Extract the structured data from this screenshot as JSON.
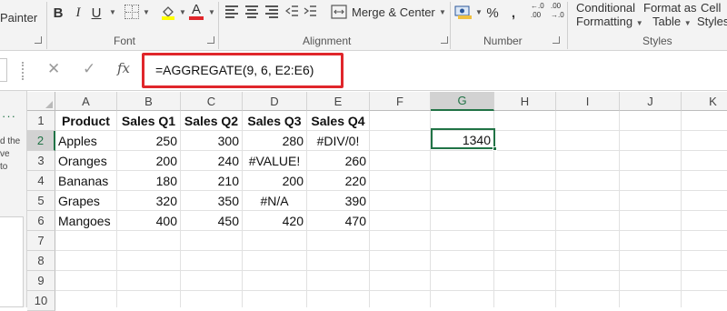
{
  "ribbon": {
    "painter_label": "Painter",
    "bold_label": "B",
    "italic_label": "I",
    "underline_label": "U",
    "font_color_glyph": "A",
    "font_group_label": "Font",
    "merge_center_label": "Merge & Center",
    "alignment_group_label": "Alignment",
    "percent_label": "%",
    "comma_label": ",",
    "increase_decimal_top": "←.0",
    "increase_decimal_bottom": ".00",
    "decrease_decimal_top": ".00",
    "decrease_decimal_bottom": "→.0",
    "number_group_label": "Number",
    "conditional_formatting_line1": "Conditional",
    "conditional_formatting_line2": "Formatting",
    "format_as_table_line1": "Format as",
    "format_as_table_line2": "Table",
    "cell_styles_line1": "Cell",
    "cell_styles_line2": "Styles",
    "styles_group_label": "Styles",
    "accent_color": "#e0262b"
  },
  "formula_bar": {
    "cancel_glyph": "✕",
    "enter_glyph": "✓",
    "fx_label": "fx",
    "formula": "=AGGREGATE(9, 6, E2:E6)"
  },
  "left_pane": {
    "dots": "···",
    "text_lines": [
      "d the",
      "ve",
      "to"
    ]
  },
  "columns": [
    "A",
    "B",
    "C",
    "D",
    "E",
    "F",
    "G",
    "H",
    "I",
    "J",
    "K"
  ],
  "rows": [
    "1",
    "2",
    "3",
    "4",
    "5",
    "6",
    "7",
    "8",
    "9",
    "10"
  ],
  "headers": [
    "Product",
    "Sales Q1",
    "Sales Q2",
    "Sales Q3",
    "Sales Q4"
  ],
  "data": [
    [
      "Apples",
      "250",
      "300",
      "280",
      "#DIV/0!"
    ],
    [
      "Oranges",
      "200",
      "240",
      "#VALUE!",
      "260"
    ],
    [
      "Bananas",
      "180",
      "210",
      "200",
      "220"
    ],
    [
      "Grapes",
      "320",
      "350",
      "#N/A",
      "390"
    ],
    [
      "Mangoes",
      "400",
      "450",
      "420",
      "470"
    ]
  ],
  "result_cell": "1340",
  "selected_cell": "G2"
}
